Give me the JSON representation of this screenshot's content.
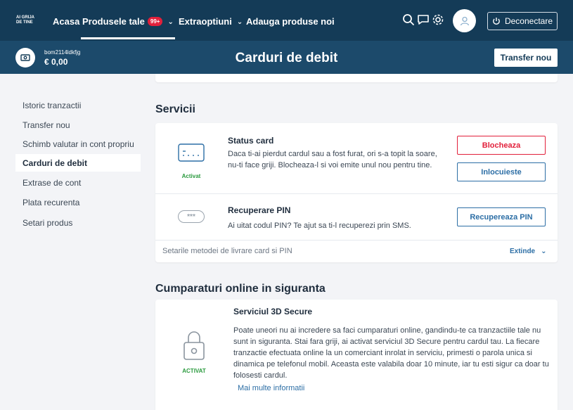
{
  "nav": {
    "brand": "AI GRIJA DE TINE",
    "home": "Acasa",
    "products": "Produsele tale",
    "products_badge": "99+",
    "extras": "Extraoptiuni",
    "add_products": "Adauga produse noi",
    "logout": "Deconectare",
    "chevron": "⌄"
  },
  "account": {
    "name": "bom2114ldkfjg",
    "balance": "€ 0,00"
  },
  "header": {
    "title": "Carduri de debit",
    "transfer_button": "Transfer nou"
  },
  "sidebar": {
    "items": [
      {
        "label": "Istoric tranzactii"
      },
      {
        "label": "Transfer nou"
      },
      {
        "label": "Schimb valutar in cont propriu"
      },
      {
        "label": "Carduri de debit"
      },
      {
        "label": "Extrase de cont"
      },
      {
        "label": "Plata recurenta"
      },
      {
        "label": "Setari produs"
      }
    ],
    "active_index": 3
  },
  "services": {
    "section_title": "Servicii",
    "status_card": {
      "title": "Status card",
      "description": "Daca ti-ai pierdut cardul sau a fost furat, ori s-a topit la soare, nu-ti face griji. Blocheaza-l si voi emite unul nou pentru tine.",
      "status": "Activat",
      "block_button": "Blocheaza",
      "replace_button": "Inlocuieste"
    },
    "pin": {
      "title": "Recuperare PIN",
      "description": "Ai uitat codul PIN? Te ajut sa ti-l recuperezi prin SMS.",
      "button": "Recupereaza PIN",
      "icon_text": "***"
    },
    "footer_text": "Setarile metodei de livrare card si PIN",
    "expand_label": "Extinde",
    "expand_chevron": "⌄"
  },
  "online": {
    "section_title": "Cumparaturi online in siguranta",
    "secure3d": {
      "title": "Serviciul 3D Secure",
      "description": "Poate uneori nu ai incredere sa faci cumparaturi online, gandindu-te ca tranzactiile tale nu sunt in siguranta. Stai fara griji, ai activat serviciul 3D Secure pentru cardul tau. La fiecare tranzactie efectuata online la un comerciant inrolat in serviciu, primesti o parola unica si dinamica pe telefonul mobil. Aceasta este valabila doar 10 minute, iar tu esti sigur ca doar tu folosesti cardul.",
      "more_link": "Mai multe informatii",
      "status": "ACTIVAT"
    }
  },
  "colors": {
    "nav_bg": "#143b57",
    "subheader_bg": "#1c4a6b",
    "badge": "#e2203b",
    "accent": "#2c6ea5",
    "active_green": "#2a9a3e"
  }
}
